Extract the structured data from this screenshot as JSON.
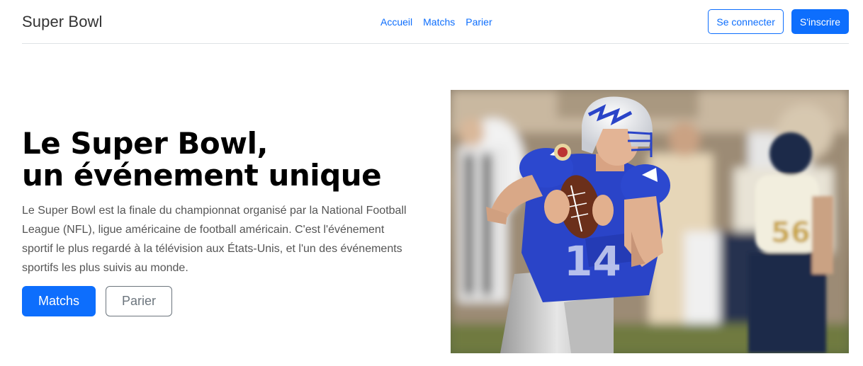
{
  "navbar": {
    "brand": "Super Bowl",
    "links": [
      "Accueil",
      "Matchs",
      "Parier"
    ],
    "login": "Se connecter",
    "signup": "S'inscrire"
  },
  "hero": {
    "title_line1": "Le Super Bowl,",
    "title_line2": "un événement unique",
    "description": "Le Super Bowl est la finale du championnat organisé par la National Football League (NFL), ligue américaine de football américain. C'est l'événement sportif le plus regardé à la télévision aux États-Unis, et l'un des événements sportifs les plus suivis au monde.",
    "primary_button": "Matchs",
    "secondary_button": "Parier",
    "image_alt": "football-quarterback-photo",
    "jersey_number": "14",
    "opponent_number": "56"
  },
  "colors": {
    "primary": "#0d6efd",
    "secondary": "#6c757d"
  }
}
